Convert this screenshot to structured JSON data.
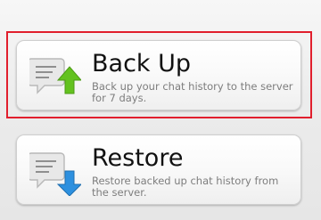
{
  "items": [
    {
      "title": "Back Up",
      "description": "Back up your chat history to the server for 7 days.",
      "icon": "chat-upload-icon",
      "selected": true
    },
    {
      "title": "Restore",
      "description": "Restore backed up chat history from the server.",
      "icon": "chat-download-icon",
      "selected": false
    }
  ],
  "colors": {
    "selection_border": "#e11f2d",
    "upload_arrow": "#63c21f",
    "download_arrow": "#2d90df"
  }
}
